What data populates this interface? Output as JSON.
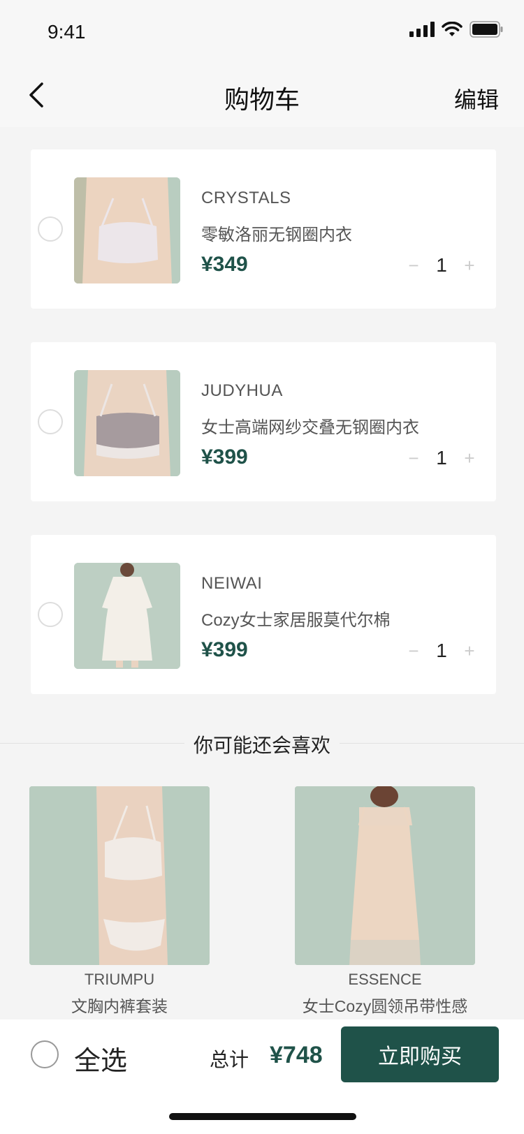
{
  "status": {
    "time": "9:41"
  },
  "nav": {
    "title": "购物车",
    "edit": "编辑"
  },
  "cart": {
    "items": [
      {
        "brand": "CRYSTALS",
        "name": "零敏洛丽无钢圈内衣",
        "price": "¥349",
        "qty": "1",
        "minus": "−",
        "plus": "+"
      },
      {
        "brand": "JUDYHUA",
        "name": "女士高端网纱交叠无钢圈内衣",
        "price": "¥399",
        "qty": "1",
        "minus": "−",
        "plus": "+"
      },
      {
        "brand": "NEIWAI",
        "name": "Cozy女士家居服莫代尔棉",
        "price": "¥399",
        "qty": "1",
        "minus": "−",
        "plus": "+"
      }
    ]
  },
  "recommend": {
    "title": "你可能还会喜欢",
    "items": [
      {
        "brand": "TRIUMPU",
        "name": "文胸内裤套装"
      },
      {
        "brand": "ESSENCE",
        "name": "女士Cozy圆领吊带性感"
      }
    ]
  },
  "footer": {
    "select_all": "全选",
    "total_label": "总计",
    "total_value": "¥748",
    "buy": "立即购买"
  },
  "colors": {
    "accent": "#1f5249",
    "background": "#f4f4f4"
  }
}
